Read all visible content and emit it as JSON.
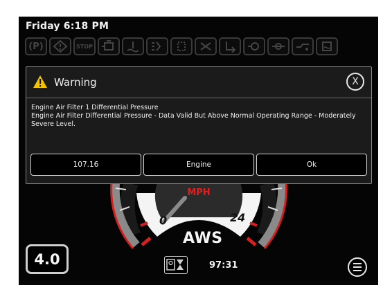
{
  "status": {
    "datetime": "Friday 6:18 PM"
  },
  "indicator_icons": [
    {
      "name": "parking-brake-icon",
      "text": "(P)"
    },
    {
      "name": "general-warning-icon",
      "text": ""
    },
    {
      "name": "stop-icon",
      "text": "STOP"
    },
    {
      "name": "engine-check-icon",
      "text": ""
    },
    {
      "name": "coolant-temp-icon",
      "text": ""
    },
    {
      "name": "regen-icon",
      "text": ""
    },
    {
      "name": "dpf-icon",
      "text": ""
    },
    {
      "name": "regen-inhibit-icon",
      "text": ""
    },
    {
      "name": "exhaust-temp-icon",
      "text": ""
    },
    {
      "name": "transmission-icon",
      "text": ""
    },
    {
      "name": "axle-icon",
      "text": ""
    },
    {
      "name": "oil-pressure-icon",
      "text": ""
    },
    {
      "name": "water-in-fuel-icon",
      "text": ""
    }
  ],
  "dialog": {
    "title": "Warning",
    "close_label": "X",
    "line1": "Engine Air Filter 1 Differential Pressure",
    "line2": "Engine Air Filter Differential Pressure - Data Valid But Above Normal Operating Range - Moderately Severe Level.",
    "buttons": [
      "107.16",
      "Engine",
      "Ok"
    ]
  },
  "gauge": {
    "unit": "MPH",
    "label_min": "0",
    "label_max": "24",
    "needle_value": 0
  },
  "footer": {
    "gear_display": "4.0",
    "mode": "AWS",
    "hour_meter": "97:31"
  },
  "colors": {
    "warning": "#f5c400",
    "gauge_red": "#d61f1f",
    "unit_red": "#e02020"
  }
}
